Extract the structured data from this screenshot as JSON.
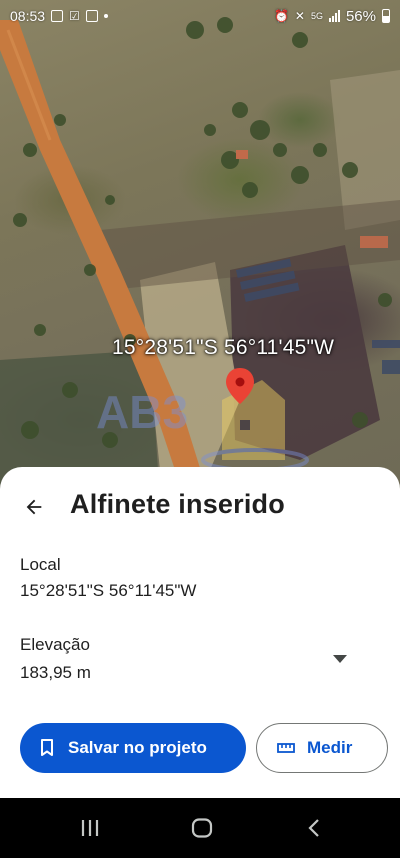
{
  "status_bar": {
    "time": "08:53",
    "network": "5G",
    "battery": "56%",
    "icons": [
      "image-icon",
      "check-icon",
      "calendar-icon",
      "dot-icon",
      "alarm-icon",
      "mute-icon",
      "signal-icon",
      "battery-icon"
    ]
  },
  "map": {
    "coordinates_overlay": "15°28'51\"S 56°11'45\"W",
    "watermark": "AB3",
    "pin_color": "#ea4335"
  },
  "sheet": {
    "title": "Alfinete inserido",
    "location_label": "Local",
    "location_value": "15°28'51\"S 56°11'45\"W",
    "elevation_label": "Elevação",
    "elevation_value": "183,95 m",
    "save_button_label": "Salvar no projeto",
    "measure_button_label": "Medir"
  },
  "colors": {
    "accent": "#0b57d0",
    "text": "#1f1f1f",
    "outline": "#747775"
  },
  "nav_bar": {
    "icons": [
      "recents-icon",
      "home-icon",
      "back-icon"
    ]
  }
}
